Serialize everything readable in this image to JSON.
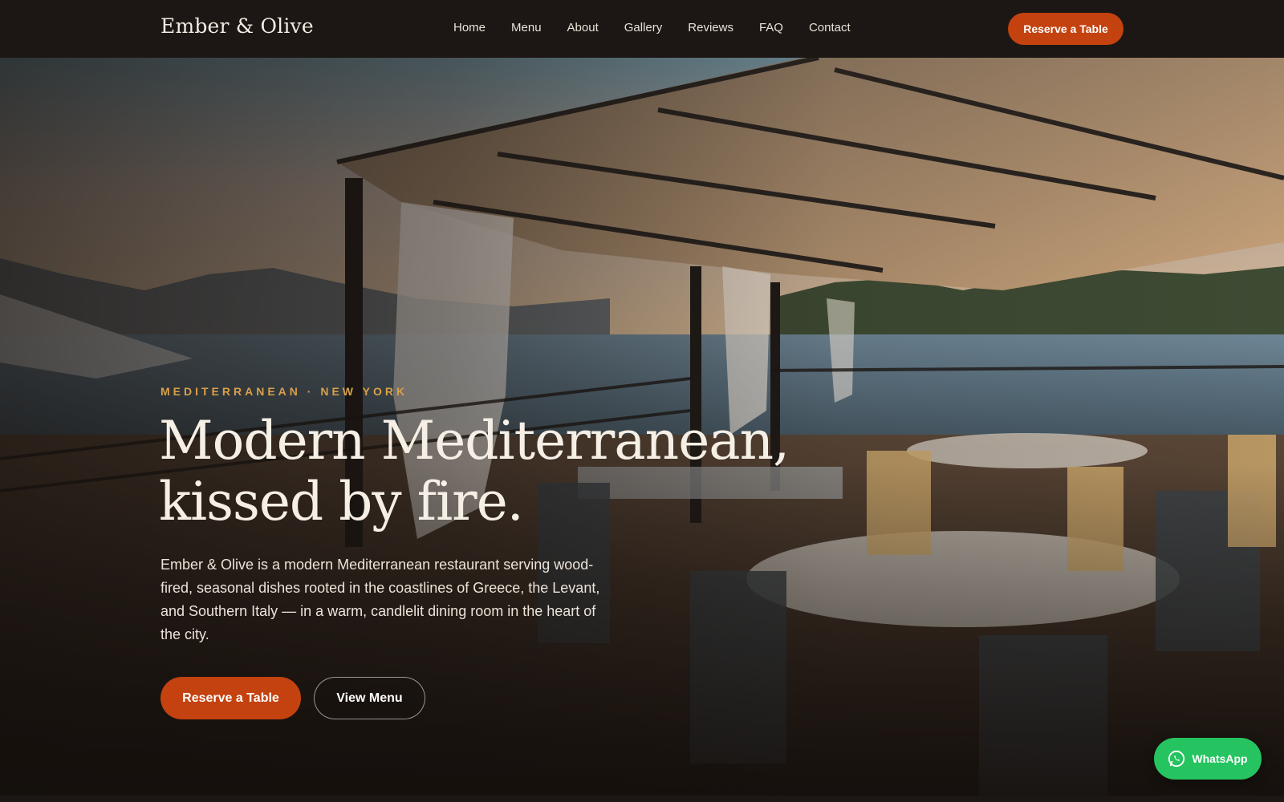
{
  "brand": {
    "name": "Ember & Olive"
  },
  "nav": {
    "items": [
      {
        "label": "Home"
      },
      {
        "label": "Menu"
      },
      {
        "label": "About"
      },
      {
        "label": "Gallery"
      },
      {
        "label": "Reviews"
      },
      {
        "label": "FAQ"
      },
      {
        "label": "Contact"
      }
    ],
    "cta_label": "Reserve a Table"
  },
  "hero": {
    "eyebrow": "MEDITERRANEAN · NEW YORK",
    "headline_line1": "Modern Mediterranean,",
    "headline_line2": "kissed by fire.",
    "description": "Ember & Olive is a modern Mediterranean restaurant serving wood-fired, seasonal dishes rooted in the coastlines of Greece, the Levant, and Southern Italy — in a warm, candlelit dining room in the heart of the city.",
    "primary_button": "Reserve a Table",
    "secondary_button": "View Menu"
  },
  "floating": {
    "whatsapp_label": "WhatsApp",
    "icon": "whatsapp-icon"
  },
  "colors": {
    "accent": "#c4420f",
    "eyebrow": "#d9a048",
    "header_bg": "#1c1714",
    "whatsapp": "#25c460"
  }
}
